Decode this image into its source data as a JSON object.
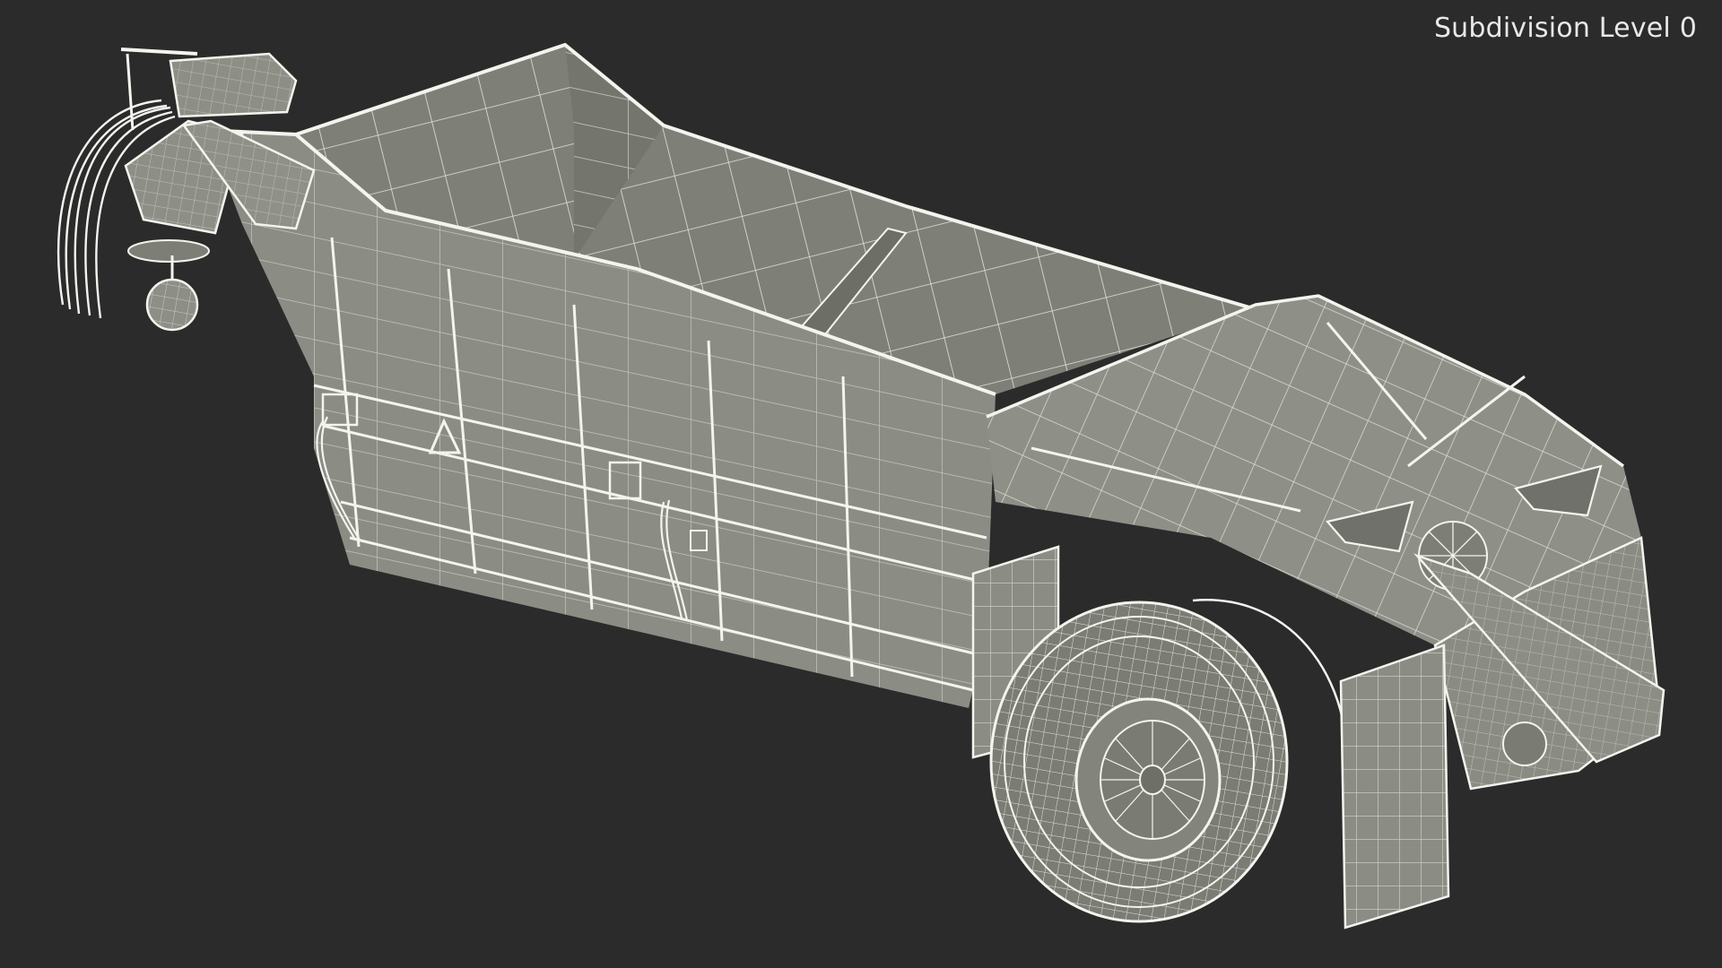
{
  "viewport": {
    "subdivision_label": "Subdivision Level 0",
    "background_color": "#2b2b2b",
    "model_color": "#8a8c82",
    "wire_color": "#f2f2ec",
    "subject": "dump trailer wireframe model"
  }
}
